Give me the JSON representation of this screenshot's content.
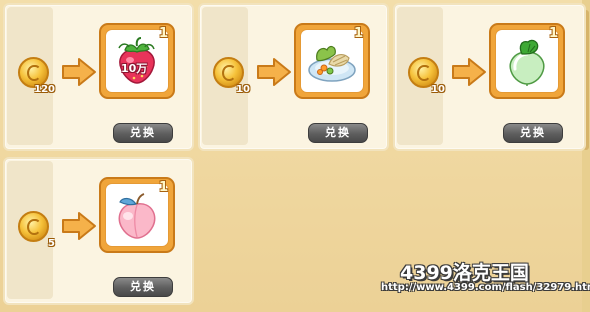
{
  "items": [
    {
      "name": "strawberry-10wan",
      "price": "120",
      "quantity": "1",
      "badge": "10万",
      "button": "兑换"
    },
    {
      "name": "food-plate",
      "price": "10",
      "quantity": "1",
      "button": "兑换"
    },
    {
      "name": "green-radish",
      "price": "10",
      "quantity": "1",
      "button": "兑换"
    },
    {
      "name": "pink-peach",
      "price": "5",
      "quantity": "1",
      "button": "兑换"
    }
  ],
  "watermark": {
    "brand": "4399洛克王国",
    "url": "http://www.4399.com/flash/32979.htm"
  },
  "colors": {
    "background": "#f3deaa",
    "card": "#fbf4e1",
    "frame": "#f0a53a",
    "button": "#5e5e5e"
  }
}
